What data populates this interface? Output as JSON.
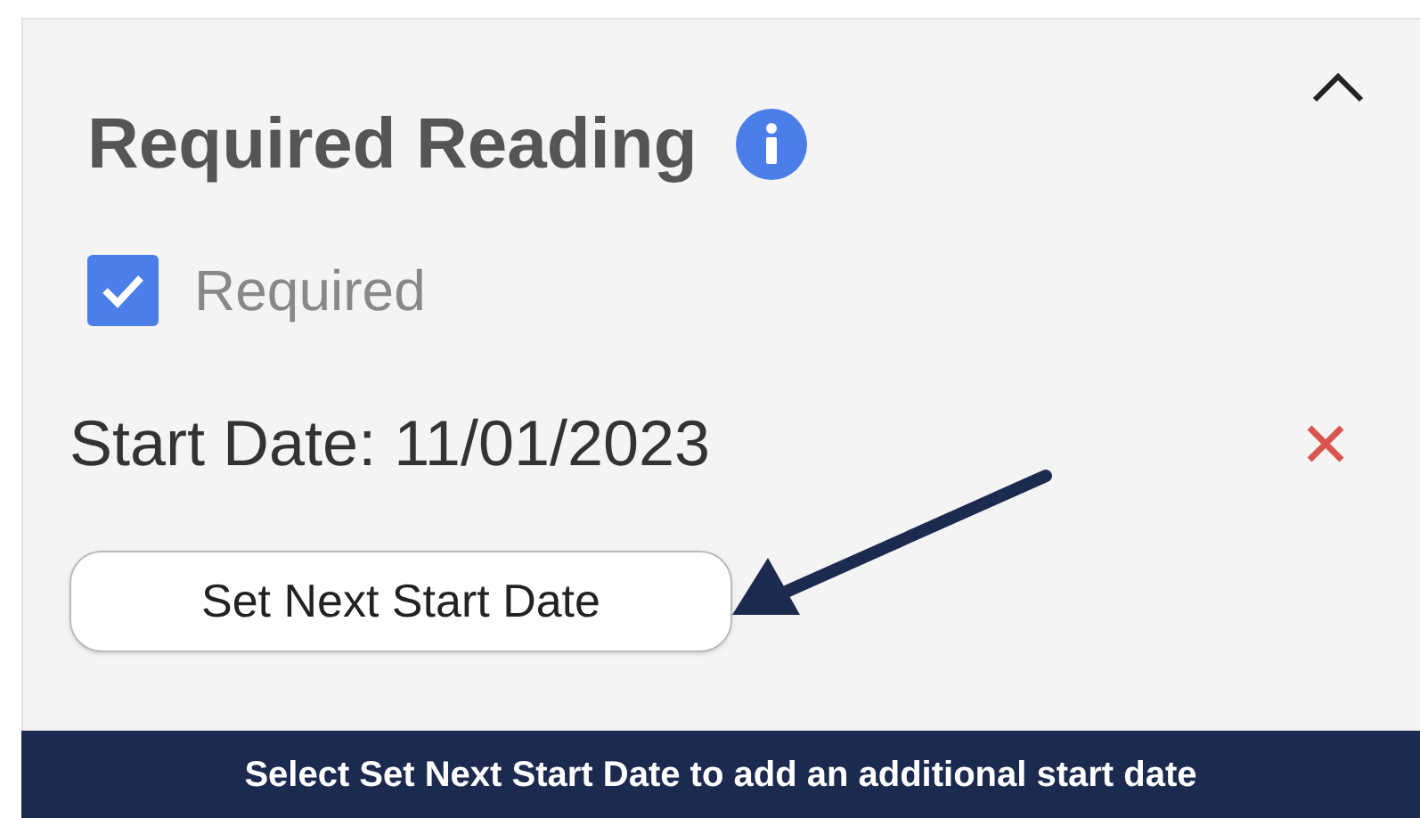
{
  "panel": {
    "title": "Required Reading",
    "expanded": true,
    "required": {
      "label": "Required",
      "checked": true
    },
    "start_date": "Start Date: 11/01/2023",
    "button": "Set Next Start Date"
  },
  "caption": "Select Set Next Start Date to add an additional start date"
}
